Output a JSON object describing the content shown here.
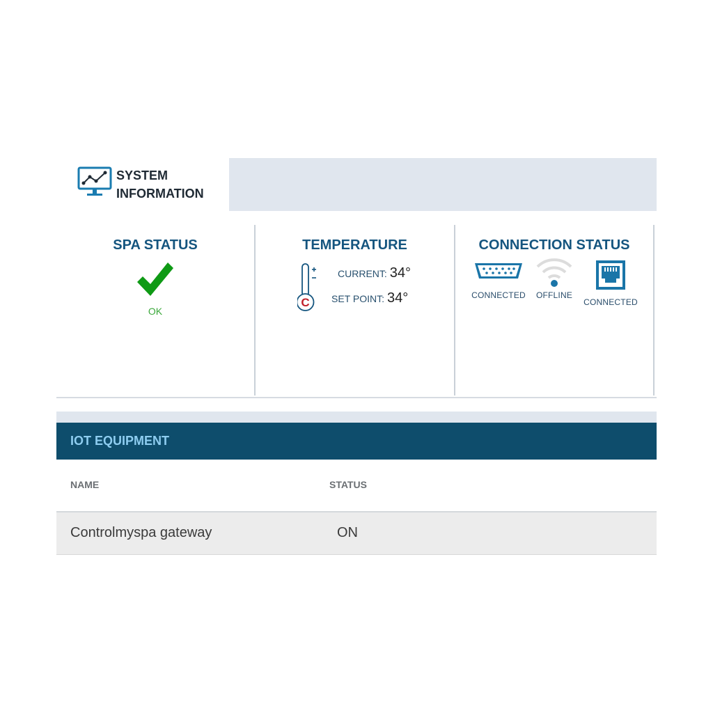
{
  "tabs": [
    {
      "label": "SYSTEM INFORMATION",
      "icon": "monitor-chart-icon"
    }
  ],
  "spa_status": {
    "title": "SPA STATUS",
    "status": "OK",
    "icon": "checkmark-icon",
    "color": "#3ba83b"
  },
  "temperature": {
    "title": "TEMPERATURE",
    "unit_badge": "C",
    "current_label": "CURRENT:",
    "current_value": "34°",
    "setpoint_label": "SET POINT:",
    "setpoint_value": "34°"
  },
  "connection": {
    "title": "CONNECTION STATUS",
    "items": [
      {
        "icon": "serial-port-icon",
        "status": "CONNECTED"
      },
      {
        "icon": "wifi-icon",
        "status": "OFFLINE"
      },
      {
        "icon": "ethernet-port-icon",
        "status": "CONNECTED"
      }
    ]
  },
  "iot": {
    "title": "IOT EQUIPMENT",
    "columns": [
      "NAME",
      "STATUS"
    ],
    "rows": [
      {
        "name": "Controlmyspa gateway",
        "status": "ON"
      }
    ]
  },
  "colors": {
    "accent": "#15557f",
    "header_bg": "#0e4d6c",
    "header_text": "#8ecdf0",
    "tab_bg": "#e0e6ee"
  }
}
